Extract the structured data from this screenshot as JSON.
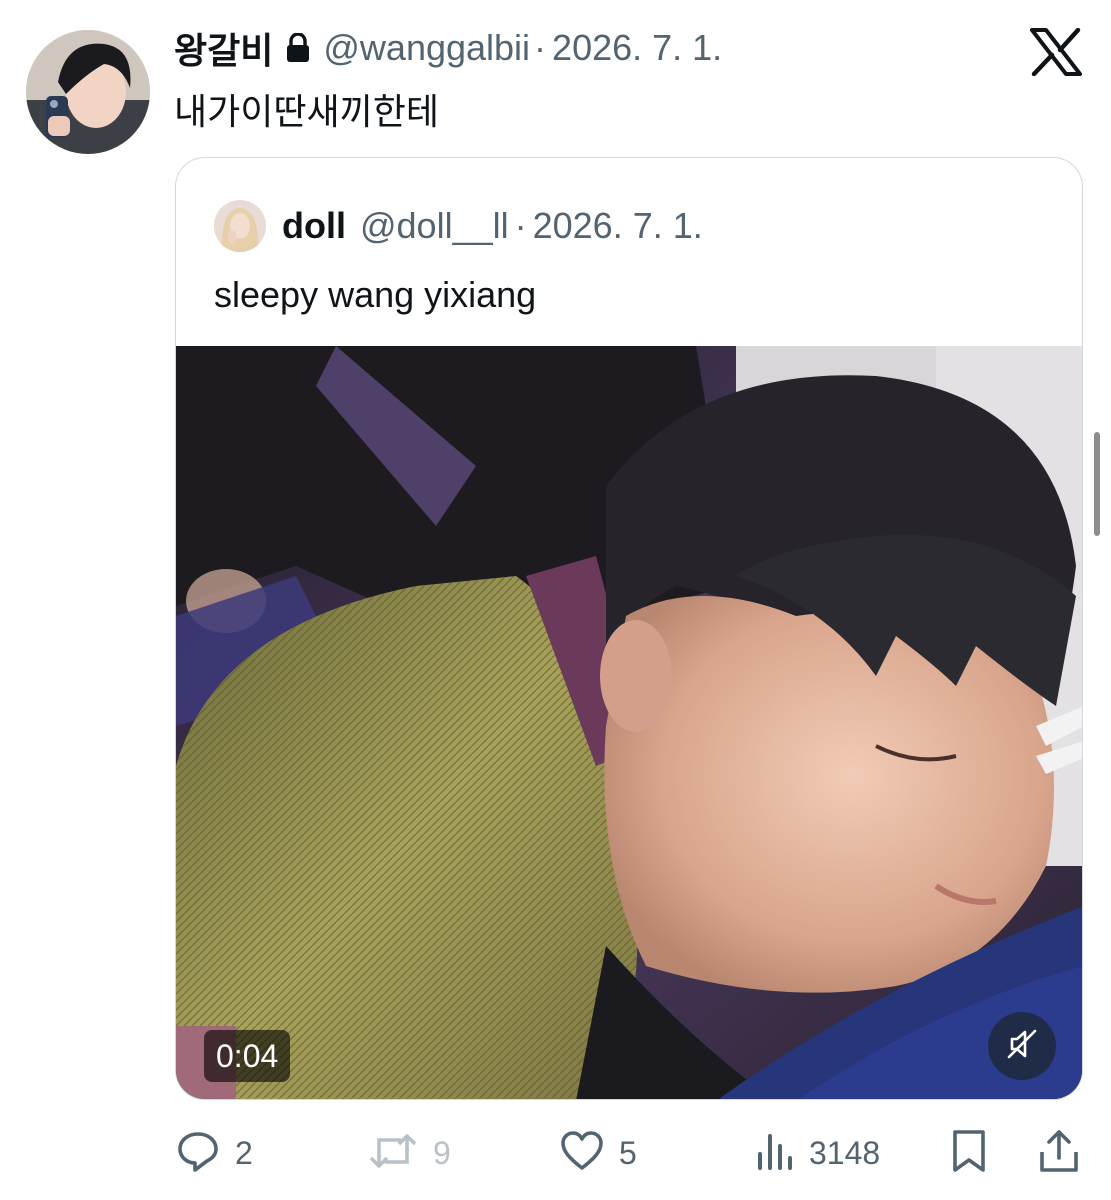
{
  "tweet": {
    "display_name": "왕갈비",
    "handle": "@wanggalbii",
    "separator": "·",
    "date": "2026. 7. 1.",
    "text": "내가이딴새끼한테",
    "icons": {
      "lock": "lock-icon",
      "platform_logo": "x-logo-icon"
    }
  },
  "quote": {
    "display_name": "doll",
    "handle": "@doll__ll",
    "separator": "·",
    "date": "2026. 7. 1.",
    "text": "sleepy wang yixiang",
    "media": {
      "type": "video",
      "duration": "0:04",
      "muted": true
    }
  },
  "actions": {
    "reply": {
      "icon": "reply-icon",
      "count": "2"
    },
    "repost": {
      "icon": "repost-icon",
      "count": "9",
      "enabled": false
    },
    "like": {
      "icon": "heart-icon",
      "count": "5"
    },
    "views": {
      "icon": "views-icon",
      "count": "3148"
    },
    "bookmark": {
      "icon": "bookmark-icon"
    },
    "share": {
      "icon": "share-icon"
    }
  },
  "colors": {
    "text_primary": "#0f1419",
    "text_secondary": "#536471",
    "border": "#cfd9de",
    "disabled": "#b8c1c8"
  }
}
